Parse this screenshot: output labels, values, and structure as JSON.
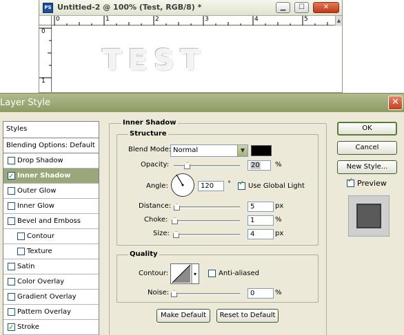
{
  "document": {
    "title": "Untitled-2 @ 100% (Test, RGB/8) *",
    "app_icon": "PS",
    "ruler_top": [
      "0",
      "1",
      "2",
      "3",
      "4",
      "5"
    ],
    "ruler_left": [
      "0",
      "1"
    ],
    "canvas_text": "TEST",
    "buttons": {
      "minimize": "▁",
      "maximize": "☐",
      "close": "✕"
    }
  },
  "dialog": {
    "title": "Layer Style",
    "close": "✕",
    "styles_header": "Styles",
    "blending_options": "Blending Options: Default",
    "style_items": [
      {
        "label": "Drop Shadow",
        "checked": false,
        "indent": false,
        "selected": false
      },
      {
        "label": "Inner Shadow",
        "checked": true,
        "indent": false,
        "selected": true
      },
      {
        "label": "Outer Glow",
        "checked": false,
        "indent": false,
        "selected": false
      },
      {
        "label": "Inner Glow",
        "checked": false,
        "indent": false,
        "selected": false
      },
      {
        "label": "Bevel and Emboss",
        "checked": false,
        "indent": false,
        "selected": false
      },
      {
        "label": "Contour",
        "checked": false,
        "indent": true,
        "selected": false
      },
      {
        "label": "Texture",
        "checked": false,
        "indent": true,
        "selected": false
      },
      {
        "label": "Satin",
        "checked": false,
        "indent": false,
        "selected": false
      },
      {
        "label": "Color Overlay",
        "checked": false,
        "indent": false,
        "selected": false
      },
      {
        "label": "Gradient Overlay",
        "checked": false,
        "indent": false,
        "selected": false
      },
      {
        "label": "Pattern Overlay",
        "checked": false,
        "indent": false,
        "selected": false
      },
      {
        "label": "Stroke",
        "checked": true,
        "indent": false,
        "selected": false
      }
    ],
    "section_title": "Inner Shadow",
    "structure": {
      "title": "Structure",
      "blend_mode_label": "Blend Mode:",
      "blend_mode_value": "Normal",
      "shadow_color": "#000000",
      "opacity_label": "Opacity:",
      "opacity_value": "20",
      "opacity_fraction": 0.2,
      "opacity_unit": "%",
      "angle_label": "Angle:",
      "angle_value": "120",
      "angle_unit": "°",
      "use_global_light_label": "Use Global Light",
      "use_global_light_checked": true,
      "distance_label": "Distance:",
      "distance_value": "5",
      "distance_unit": "px",
      "choke_label": "Choke:",
      "choke_value": "1",
      "choke_unit": "%",
      "size_label": "Size:",
      "size_value": "4",
      "size_unit": "px"
    },
    "quality": {
      "title": "Quality",
      "contour_label": "Contour:",
      "anti_aliased_label": "Anti-aliased",
      "anti_aliased_checked": false,
      "noise_label": "Noise:",
      "noise_value": "0",
      "noise_unit": "%"
    },
    "make_default": "Make Default",
    "reset_to_default": "Reset to Default",
    "ok": "OK",
    "cancel": "Cancel",
    "new_style": "New Style...",
    "preview_label": "Preview",
    "preview_checked": true,
    "accent_color": "#9aa77b"
  }
}
